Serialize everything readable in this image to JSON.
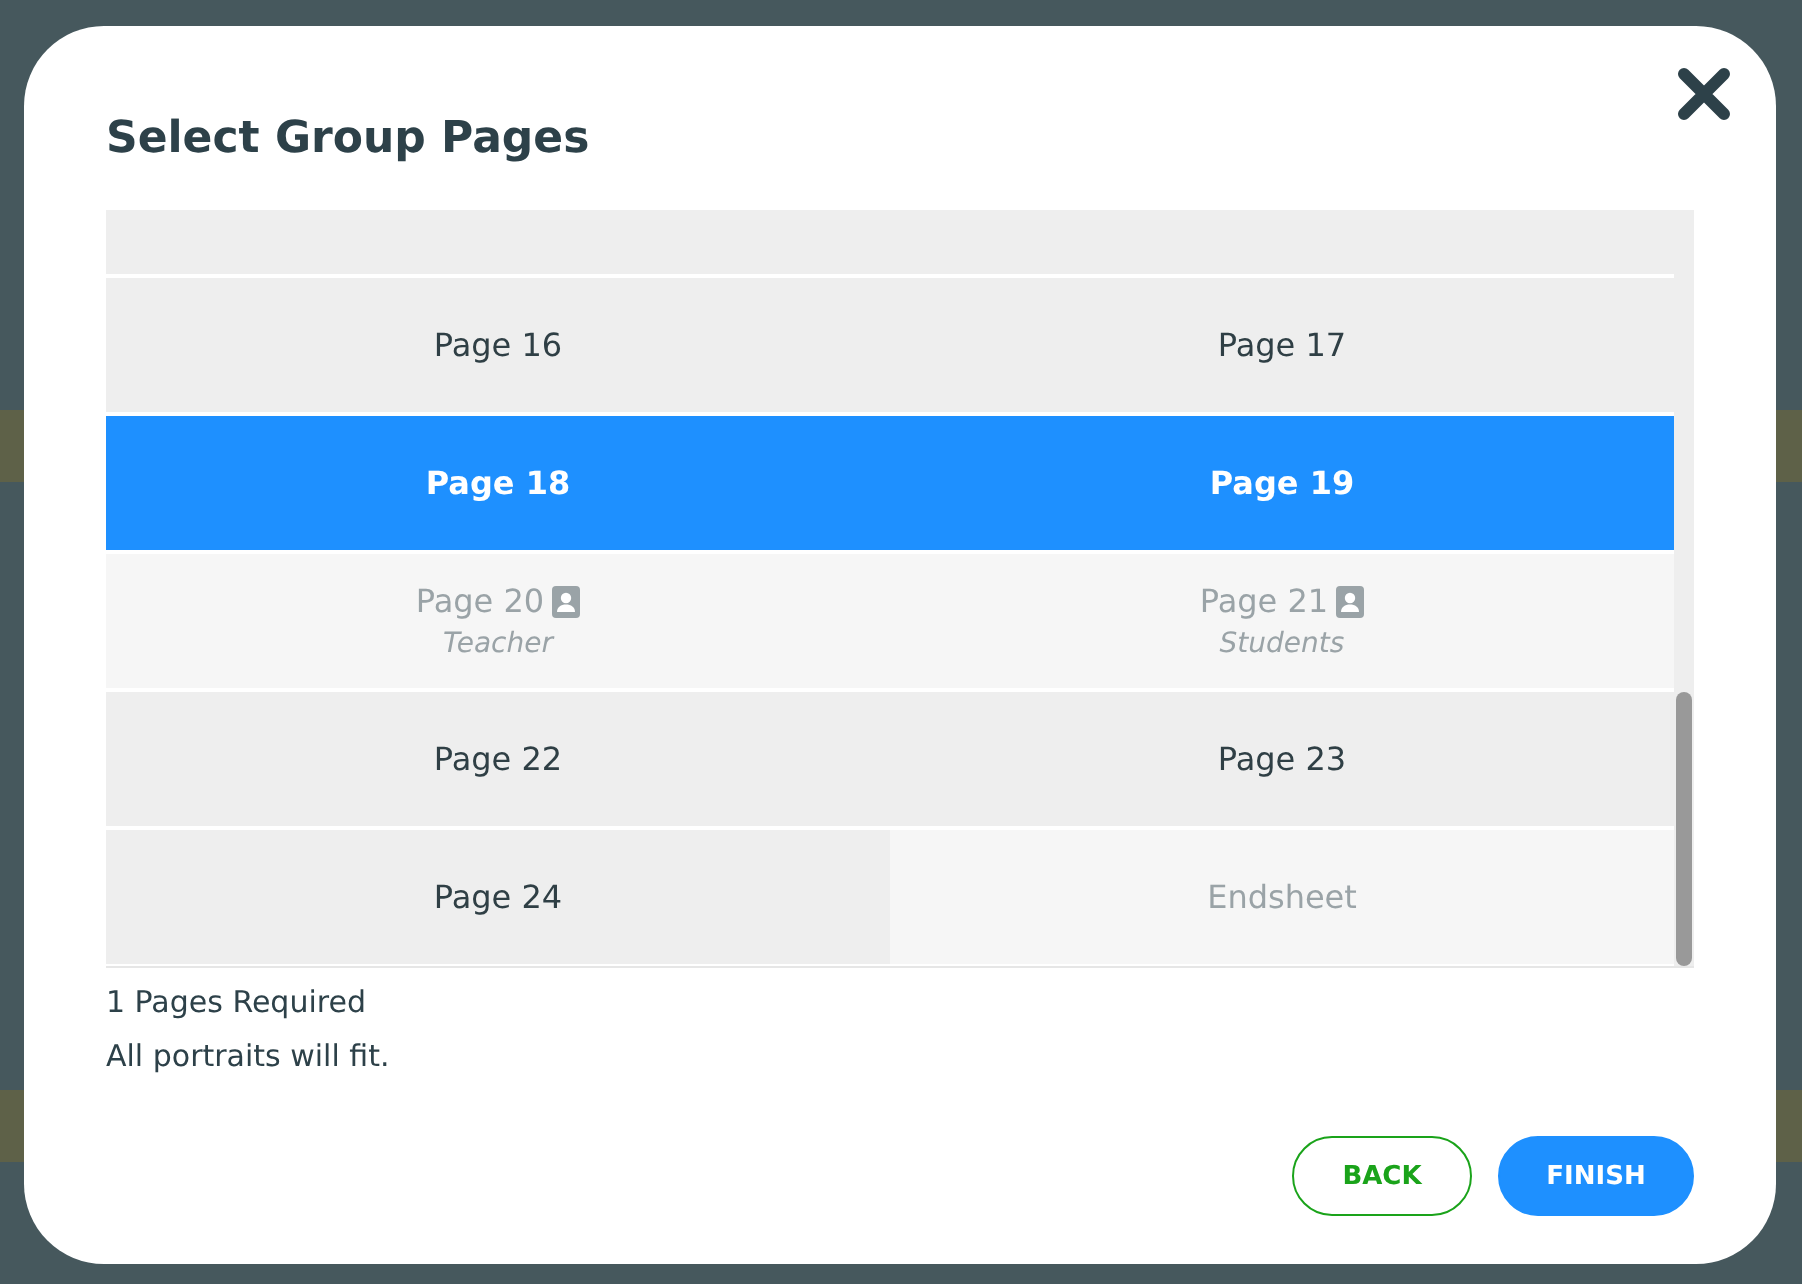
{
  "dialog": {
    "title": "Select Group Pages"
  },
  "pages": [
    {
      "label": "Page 16",
      "selected": false,
      "disabled": false
    },
    {
      "label": "Page 17",
      "selected": false,
      "disabled": false
    },
    {
      "label": "Page 18",
      "selected": true,
      "disabled": false
    },
    {
      "label": "Page 19",
      "selected": true,
      "disabled": false
    },
    {
      "label": "Page 20",
      "sublabel": "Teacher",
      "portrait": true,
      "selected": false,
      "disabled": true
    },
    {
      "label": "Page 21",
      "sublabel": "Students",
      "portrait": true,
      "selected": false,
      "disabled": true
    },
    {
      "label": "Page 22",
      "selected": false,
      "disabled": false
    },
    {
      "label": "Page 23",
      "selected": false,
      "disabled": false
    },
    {
      "label": "Page 24",
      "selected": false,
      "disabled": false
    },
    {
      "label": "Endsheet",
      "selected": false,
      "disabled": true
    }
  ],
  "summary": [
    "1 Pages Required",
    "All portraits will fit."
  ],
  "buttons": [
    {
      "label": "BACK",
      "kind": "secondary"
    },
    {
      "label": "FINISH",
      "kind": "primary"
    }
  ]
}
